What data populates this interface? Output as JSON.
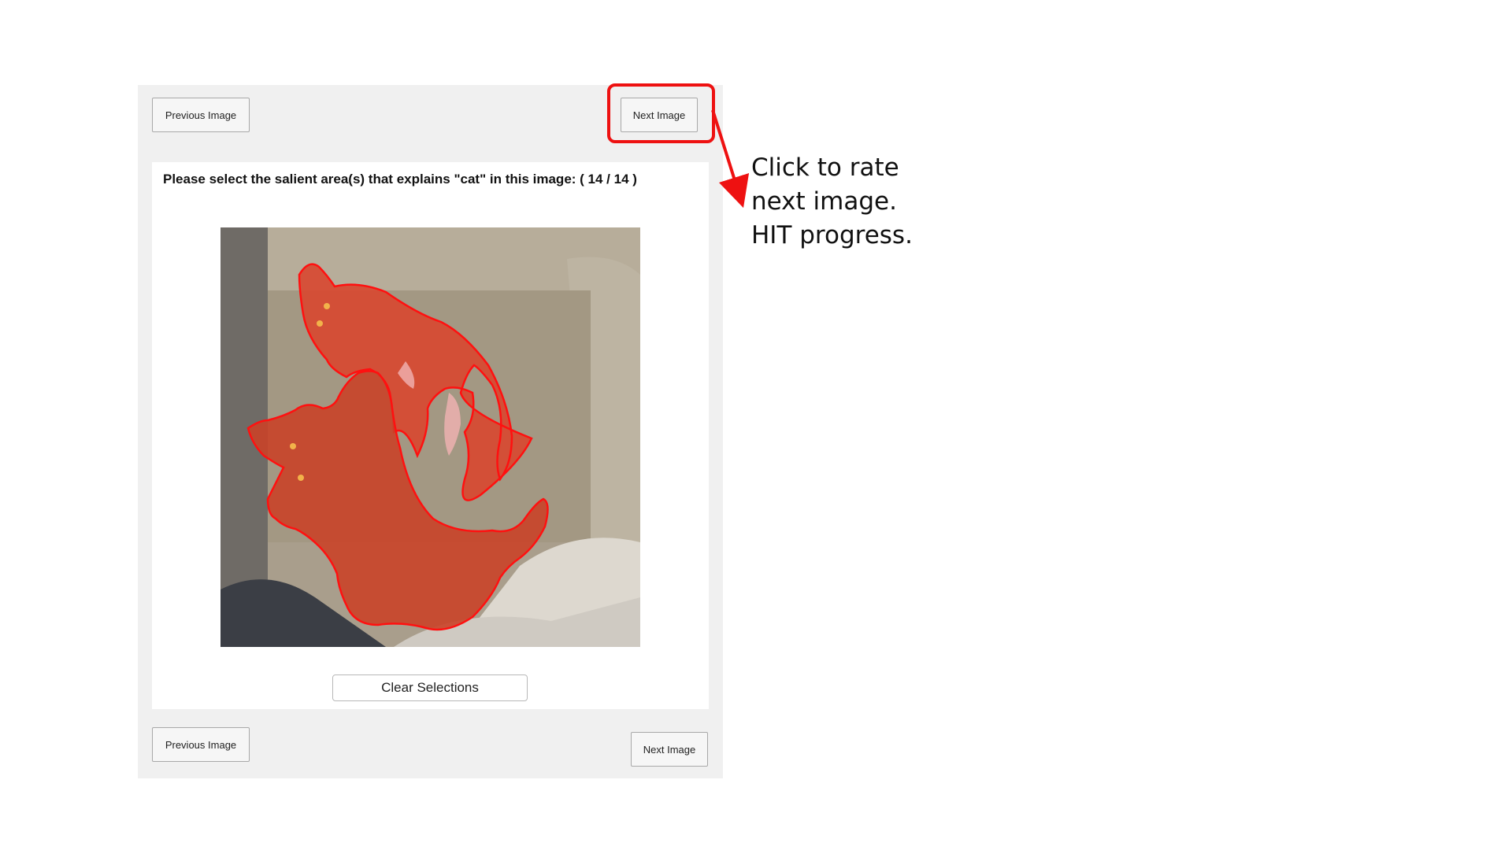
{
  "nav": {
    "previous_label": "Previous Image",
    "next_label": "Next Image"
  },
  "prompt": {
    "text": "Please select the salient area(s) that explains \"cat\" in this image: ( 14 / 14 )"
  },
  "controls": {
    "clear_label": "Clear Selections"
  },
  "annotation": {
    "lines": [
      "Click to rate",
      "next image.",
      "HIT progress."
    ]
  },
  "colors": {
    "highlight": "#ee1111",
    "selection_fill": "#d9442c",
    "selection_outline": "#ff1010",
    "panel_bg": "#f0f0f0"
  }
}
